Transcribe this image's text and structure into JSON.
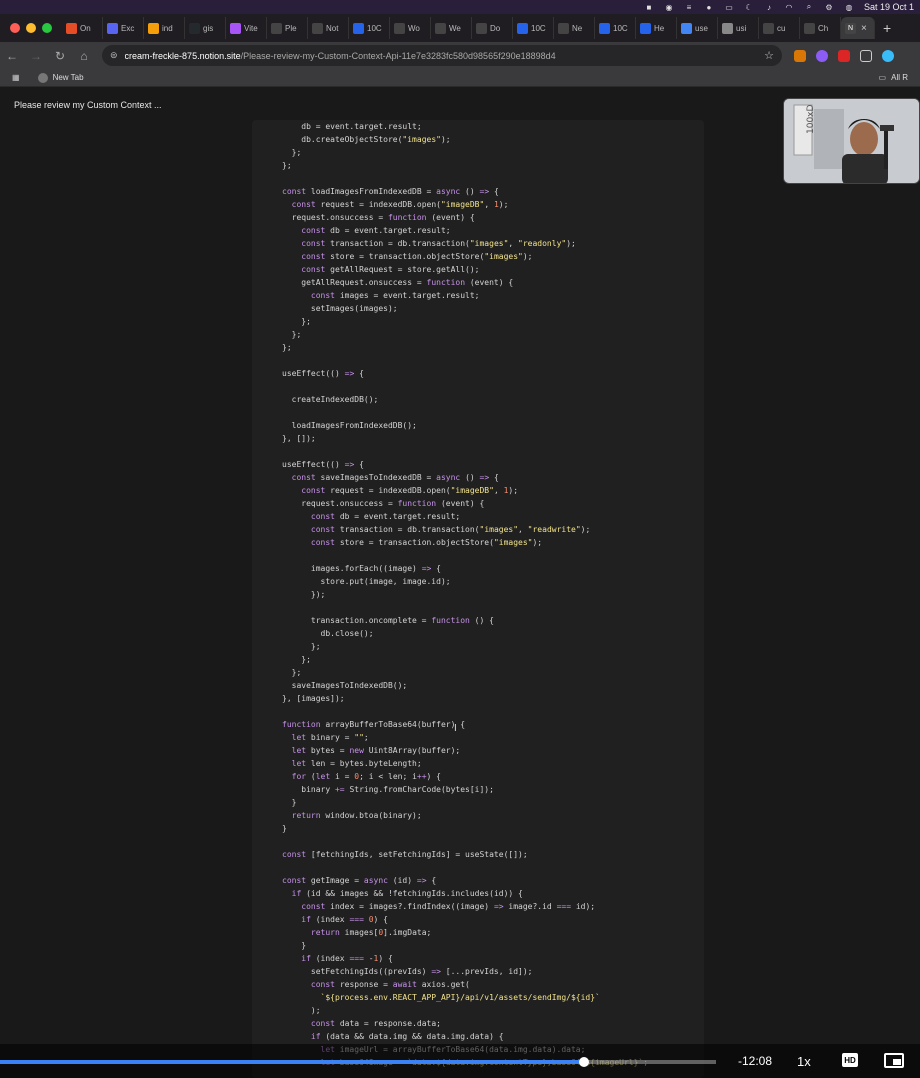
{
  "system_bar": {
    "clock": "Sat 19 Oct 1"
  },
  "tabs": [
    {
      "label": "On",
      "color": "#e44d26"
    },
    {
      "label": "Exc",
      "color": "#5865f2"
    },
    {
      "label": "ind",
      "color": "#f59e0b"
    },
    {
      "label": "gis",
      "color": "#24292e"
    },
    {
      "label": "Vite",
      "color": "#a855f7"
    },
    {
      "label": "Ple",
      "color": "#444444"
    },
    {
      "label": "Not",
      "color": "#444444"
    },
    {
      "label": "10C",
      "color": "#2563eb"
    },
    {
      "label": "Wo",
      "color": "#444444"
    },
    {
      "label": "We",
      "color": "#444444"
    },
    {
      "label": "Do",
      "color": "#444444"
    },
    {
      "label": "10C",
      "color": "#2563eb"
    },
    {
      "label": "Ne",
      "color": "#444444"
    },
    {
      "label": "10C",
      "color": "#2563eb"
    },
    {
      "label": "He",
      "color": "#2563eb"
    },
    {
      "label": "use",
      "color": "#4285f4"
    },
    {
      "label": "usi",
      "color": "#888888"
    },
    {
      "label": "cu",
      "color": "#444444"
    },
    {
      "label": "Ch",
      "color": "#444444"
    }
  ],
  "active_tab": {
    "label": "N"
  },
  "address_bar": {
    "host": "cream-freckle-875.notion.site",
    "path": "/Please-review-my-Custom-Context-Api-11e7e3283fc580d98565f290e18898d4"
  },
  "bookmarks": {
    "new_tab": "New Tab",
    "all": "All R"
  },
  "page": {
    "title": "Please review my Custom Context ..."
  },
  "code_lines": [
    "    db = event.target.result;",
    "    db.createObjectStore(\"images\");",
    "  };",
    "};",
    "",
    "const loadImagesFromIndexedDB = async () => {",
    "  const request = indexedDB.open(\"imageDB\", 1);",
    "  request.onsuccess = function (event) {",
    "    const db = event.target.result;",
    "    const transaction = db.transaction(\"images\", \"readonly\");",
    "    const store = transaction.objectStore(\"images\");",
    "    const getAllRequest = store.getAll();",
    "    getAllRequest.onsuccess = function (event) {",
    "      const images = event.target.result;",
    "      setImages(images);",
    "    };",
    "  };",
    "};",
    "",
    "useEffect(() => {",
    "",
    "  createIndexedDB();",
    "",
    "  loadImagesFromIndexedDB();",
    "}, []);",
    "",
    "useEffect(() => {",
    "  const saveImagesToIndexedDB = async () => {",
    "    const request = indexedDB.open(\"imageDB\", 1);",
    "    request.onsuccess = function (event) {",
    "      const db = event.target.result;",
    "      const transaction = db.transaction(\"images\", \"readwrite\");",
    "      const store = transaction.objectStore(\"images\");",
    "",
    "      images.forEach((image) => {",
    "        store.put(image, image.id);",
    "      });",
    "",
    "      transaction.oncomplete = function () {",
    "        db.close();",
    "      };",
    "    };",
    "  };",
    "  saveImagesToIndexedDB();",
    "}, [images]);",
    "",
    "function arrayBufferToBase64(buffer) {",
    "  let binary = \"\";",
    "  let bytes = new Uint8Array(buffer);",
    "  let len = bytes.byteLength;",
    "  for (let i = 0; i < len; i++) {",
    "    binary += String.fromCharCode(bytes[i]);",
    "  }",
    "  return window.btoa(binary);",
    "}",
    "",
    "const [fetchingIds, setFetchingIds] = useState([]);",
    "",
    "const getImage = async (id) => {",
    "  if (id && images && !fetchingIds.includes(id)) {",
    "    const index = images?.findIndex((image) => image?.id === id);",
    "    if (index === 0) {",
    "      return images[0].imgData;",
    "    }",
    "    if (index === -1) {",
    "      setFetchingIds((prevIds) => [...prevIds, id]);",
    "      const response = await axios.get(",
    "        `${process.env.REACT_APP_API}/api/v1/assets/sendImg/${id}`",
    "      );",
    "      const data = response.data;",
    "      if (data && data.img && data.img.data) {",
    "        let imageUrl = arrayBufferToBase64(data.img.data).data;",
    "        let base64Image = `data:${data.img.contentType};base64,${imageUrl}`;"
  ],
  "player": {
    "progress": 0.815,
    "time_remaining": "-12:08",
    "speed": "1x",
    "hd_label": "HD"
  }
}
